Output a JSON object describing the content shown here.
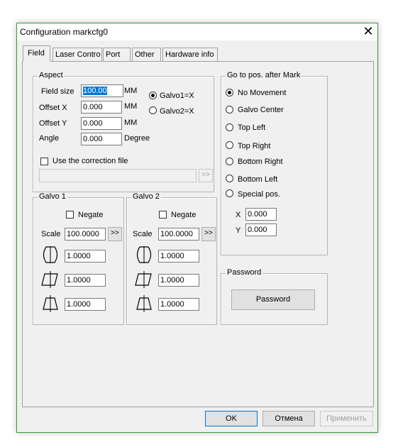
{
  "window": {
    "title": "Configuration markcfg0"
  },
  "tabs": [
    "Field",
    "Laser Contro",
    "Port",
    "Other",
    "Hardware info"
  ],
  "aspect": {
    "legend": "Aspect",
    "field_size_label": "Field size",
    "field_size_value": "100.00",
    "field_size_unit": "MM",
    "offset_x_label": "Offset X",
    "offset_x_value": "0.000",
    "offset_x_unit": "MM",
    "offset_y_label": "Offset Y",
    "offset_y_value": "0.000",
    "offset_y_unit": "MM",
    "angle_label": "Angle",
    "angle_value": "0.000",
    "angle_unit": "Degree",
    "galvo1x_label": "Galvo1=X",
    "galvo2x_label": "Galvo2=X",
    "correction_label": "Use the correction file",
    "correction_path": "",
    "browse_label": ">>"
  },
  "galvo1": {
    "legend": "Galvo 1",
    "negate_label": "Negate",
    "scale_label": "Scale",
    "scale_value": "100.0000",
    "scale_btn": ">>",
    "p1": "1.0000",
    "p2": "1.0000",
    "p3": "1.0000"
  },
  "galvo2": {
    "legend": "Galvo 2",
    "negate_label": "Negate",
    "scale_label": "Scale",
    "scale_value": "100.0000",
    "scale_btn": ">>",
    "p1": "1.0000",
    "p2": "1.0000",
    "p3": "1.0000"
  },
  "gotopos": {
    "legend": "Go to pos. after Mark",
    "options": [
      "No Movement",
      "Galvo Center",
      "Top Left",
      "Top Right",
      "Bottom Right",
      "Bottom Left",
      "Special pos."
    ],
    "x_label": "X",
    "x_value": "0.000",
    "y_label": "Y",
    "y_value": "0.000"
  },
  "password": {
    "legend": "Password",
    "button": "Password"
  },
  "footer": {
    "ok": "OK",
    "cancel": "Отмена",
    "apply": "Применить"
  }
}
